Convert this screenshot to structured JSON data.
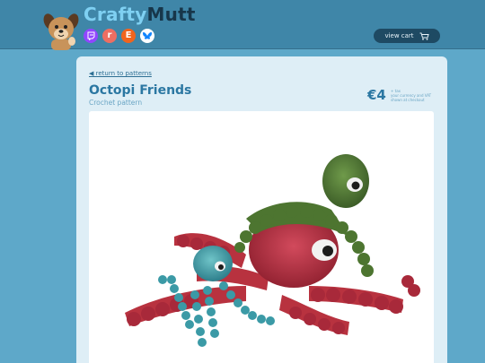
{
  "header": {
    "brand_part1": "Crafty",
    "brand_part2": "Mutt",
    "cart_label": "view cart",
    "socials": [
      {
        "name": "twitch",
        "glyph": ""
      },
      {
        "name": "ravelry",
        "glyph": "r"
      },
      {
        "name": "etsy",
        "glyph": "E"
      },
      {
        "name": "bluesky",
        "glyph": ""
      }
    ],
    "accent_color": "#7fd0f2",
    "header_color": "#3f86a8"
  },
  "product": {
    "back_link": "◀ return to patterns",
    "title": "Octopi Friends",
    "subtitle": "Crochet pattern",
    "price": "€4",
    "price_note_lines": [
      "+ tax",
      "your currency and VAT",
      "shown at checkout"
    ]
  }
}
